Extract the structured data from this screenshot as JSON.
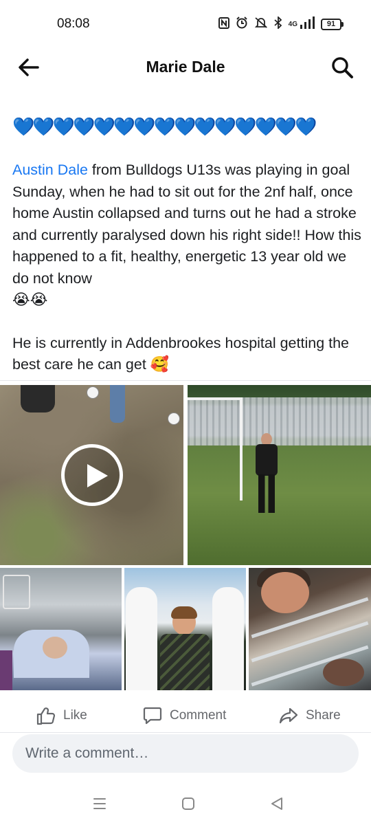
{
  "status_bar": {
    "time": "08:08",
    "network": "4G",
    "battery": "91",
    "icons": [
      "nfc-icon",
      "alarm-icon",
      "mute-icon",
      "bluetooth-icon",
      "signal-icon",
      "battery-icon"
    ]
  },
  "header": {
    "title": "Marie Dale",
    "back_icon": "arrow-left-icon",
    "search_icon": "search-icon"
  },
  "post": {
    "hearts": "💙💙💙💙💙💙💙💙💙💙💙💙💙💙💙",
    "mention": "Austin Dale",
    "paragraph1": " from Bulldogs U13s was playing in goal Sunday, when he had to sit out for the 2nf half, once home Austin collapsed and turns out he had a stroke and currently paralysed down his right side!! How this happened to a fit, healthy, energetic 13 year old we do not know",
    "paragraph1_emoji": "😭😭",
    "paragraph2": "He is currently in Addenbrookes hospital getting the best care he can get",
    "paragraph2_emoji": "🥰",
    "media": [
      {
        "type": "video",
        "icon": "play-icon"
      },
      {
        "type": "photo"
      },
      {
        "type": "photo"
      },
      {
        "type": "photo"
      },
      {
        "type": "photo"
      }
    ]
  },
  "actions": {
    "like": "Like",
    "comment": "Comment",
    "share": "Share"
  },
  "comment_box": {
    "placeholder": "Write a comment…"
  },
  "nav_bar": {
    "icons": [
      "menu-icon",
      "home-icon",
      "back-icon"
    ]
  },
  "colors": {
    "link": "#1877f2",
    "action_text": "#65676b",
    "input_bg": "#f0f2f5",
    "heart": "#4fb3f4"
  }
}
